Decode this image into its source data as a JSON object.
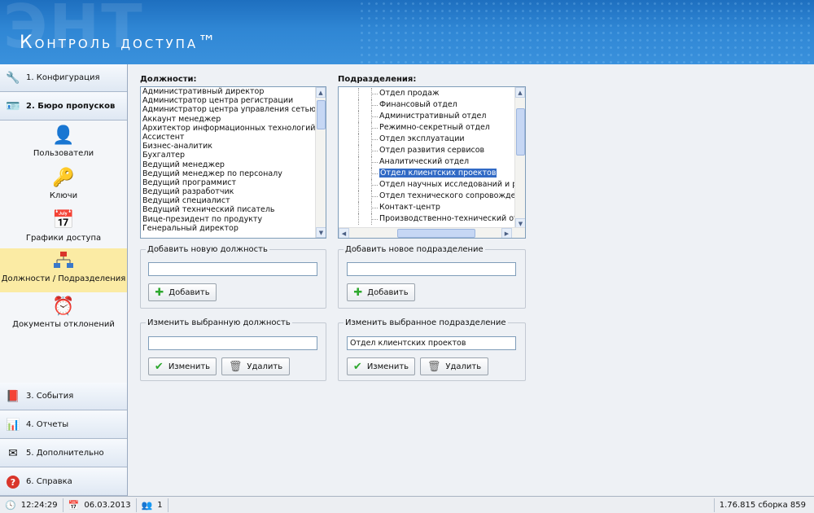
{
  "app": {
    "bg_letters": "ЭНТ",
    "title": "Контроль доступа™"
  },
  "sidebar": {
    "top_buttons": [
      {
        "label": "1. Конфигурация",
        "icon": "wrench-icon"
      },
      {
        "label": "2. Бюро пропусков",
        "icon": "id-card-icon"
      }
    ],
    "sub_items": [
      {
        "label": "Пользователи",
        "icon": "user-card-icon"
      },
      {
        "label": "Ключи",
        "icon": "key-icon"
      },
      {
        "label": "Графики доступа",
        "icon": "calendar-grid-icon"
      },
      {
        "label": "Должности / Подразделения",
        "icon": "org-chart-icon"
      },
      {
        "label": "Документы отклонений",
        "icon": "alarm-clock-icon"
      }
    ],
    "bottom_buttons": [
      {
        "label": "3. События",
        "icon": "book-icon"
      },
      {
        "label": "4. Отчеты",
        "icon": "bar-chart-icon"
      },
      {
        "label": "5. Дополнительно",
        "icon": "envelope-icon"
      },
      {
        "label": "6. Справка",
        "icon": "help-icon"
      }
    ]
  },
  "positions": {
    "label": "Должности:",
    "items": [
      "Административный директор",
      "Администратор центра регистрации",
      "Администратор центра управления сетью",
      "Аккаунт менеджер",
      "Архитектор информационных технологий",
      "Ассистент",
      "Бизнес-аналитик",
      "Бухгалтер",
      "Ведущий менеджер",
      "Ведущий менеджер по персоналу",
      "Ведущий программист",
      "Ведущий разработчик",
      "Ведущий специалист",
      "Ведущий технический писатель",
      "Вице-президент по продукту",
      "Генеральный директор"
    ]
  },
  "departments": {
    "label": "Подразделения:",
    "items": [
      "Отдел продаж",
      "Финансовый отдел",
      "Административный отдел",
      "Режимно-секретный отдел",
      "Отдел эксплуатации",
      "Отдел развития сервисов",
      "Аналитический отдел",
      "Отдел клиентских проектов",
      "Отдел научных исследований и разв",
      "Отдел технического сопровождения",
      "Контакт-центр",
      "Производственно-технический отде"
    ],
    "selected": "Отдел клиентских проектов"
  },
  "add_position": {
    "legend": "Добавить новую должность",
    "value": "",
    "button": "Добавить"
  },
  "add_department": {
    "legend": "Добавить новое подразделение",
    "value": "",
    "button": "Добавить"
  },
  "edit_position": {
    "legend": "Изменить выбранную должность",
    "value": "",
    "edit_button": "Изменить",
    "delete_button": "Удалить"
  },
  "edit_department": {
    "legend": "Изменить выбранное подразделение",
    "value": "Отдел клиентских проектов",
    "edit_button": "Изменить",
    "delete_button": "Удалить"
  },
  "status": {
    "time": "12:24:29",
    "date": "06.03.2013",
    "users": "1",
    "version": "1.76.815 сборка 859"
  },
  "colors": {
    "header": "#2f86d4",
    "selected_nav": "#fbeba4",
    "selection": "#316ac5",
    "add_icon": "#2ea82e",
    "ok_icon": "#2ea82e"
  }
}
